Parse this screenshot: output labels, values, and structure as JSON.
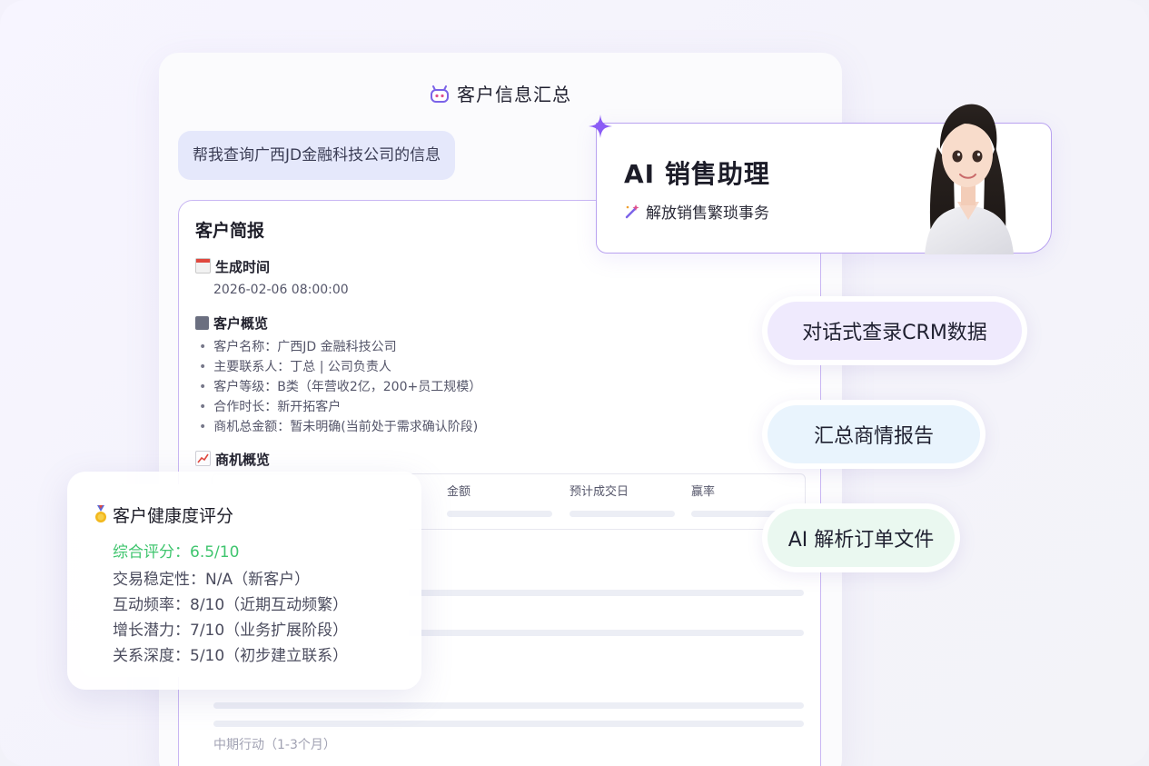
{
  "doc": {
    "title": "客户信息汇总",
    "query": "帮我查询广西JD金融科技公司的信息",
    "report": {
      "heading": "客户简报",
      "gen_time_label": "生成时间",
      "gen_time": "2026-02-06  08:00:00",
      "overview_label": "客户概览",
      "overview_items": [
        "客户名称：广西JD 金融科技公司",
        "主要联系人：丁总 | 公司负责人",
        "客户等级：B类（年营收2亿，200+员工规模）",
        "合作时长：新开拓客户",
        "商机总金额：暂未明确(当前处于需求确认阶段)"
      ],
      "opportunity_label": "商机概览",
      "table_headers": [
        "金额",
        "预计成交日",
        "赢率"
      ],
      "mid_term": "中期行动（1-3个月）"
    }
  },
  "ai_card": {
    "title": "AI 销售助理",
    "subtitle": "解放销售繁琐事务"
  },
  "features": [
    "对话式查录CRM数据",
    "汇总商情报告",
    "AI 解析订单文件"
  ],
  "health": {
    "title": "客户健康度评分",
    "overall": "综合评分：6.5/10",
    "lines": [
      "交易稳定性：N/A（新客户）",
      "互动频率：8/10（近期互动频繁）",
      "增长潜力：7/10（业务扩展阶段）",
      "关系深度：5/10（初步建立联系）"
    ]
  },
  "colors": {
    "accent_purple": "#b9a2f0",
    "score_green": "#3fc56e",
    "pill1_bg": "#efeafd",
    "pill2_bg": "#e9f4fd",
    "pill3_bg": "#eaf8f0"
  }
}
